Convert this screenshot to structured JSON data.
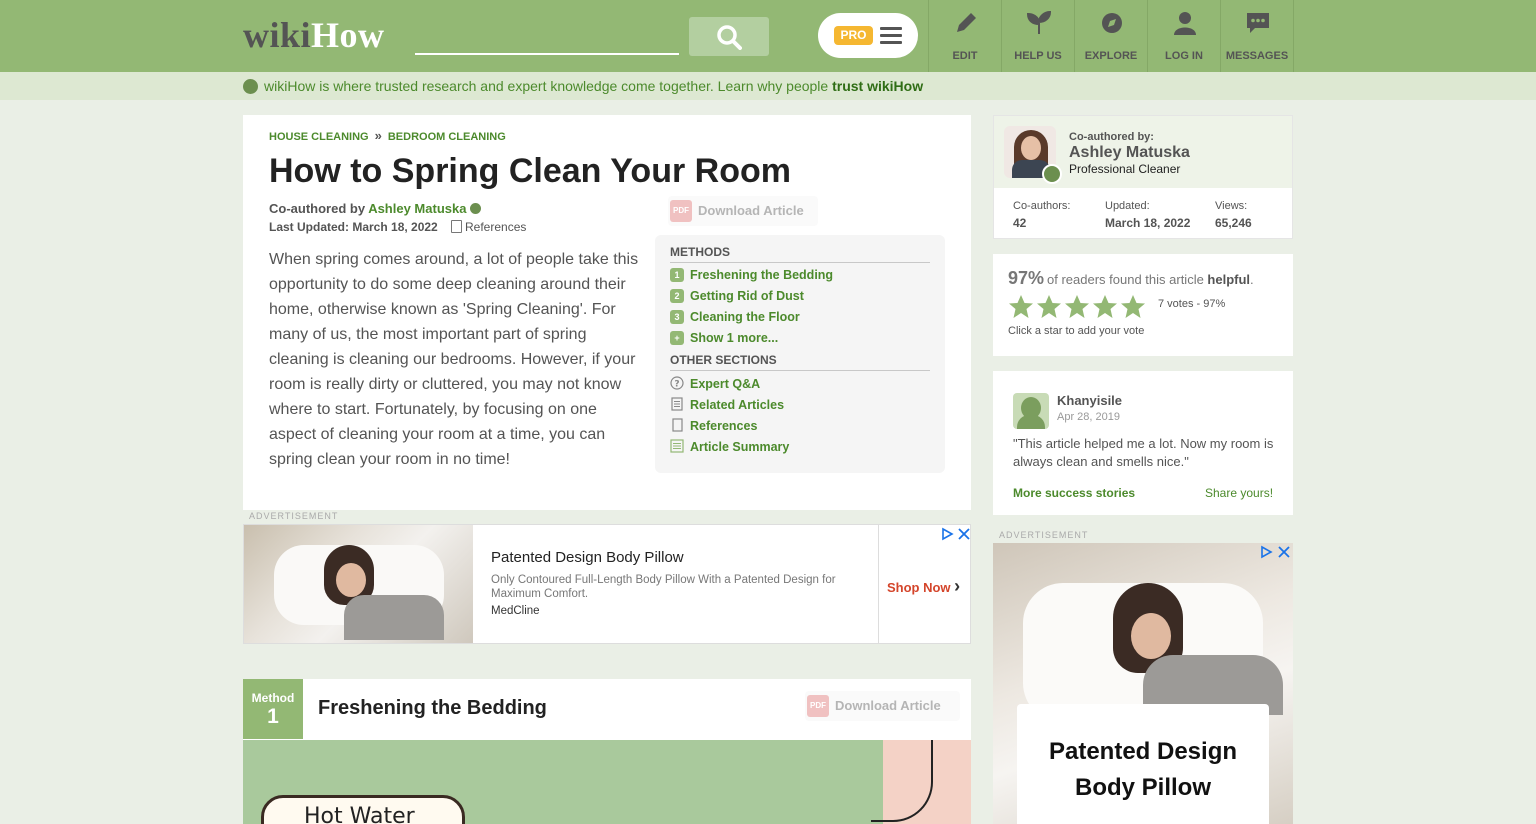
{
  "header": {
    "logo_wiki": "wiki",
    "logo_how": "How",
    "search_placeholder": "",
    "pro_label": "PRO",
    "nav": [
      {
        "label": "EDIT",
        "icon": "pencil-icon"
      },
      {
        "label": "HELP US",
        "icon": "sprout-icon"
      },
      {
        "label": "EXPLORE",
        "icon": "compass-icon"
      },
      {
        "label": "LOG IN",
        "icon": "person-icon"
      },
      {
        "label": "MESSAGES",
        "icon": "chat-icon"
      }
    ]
  },
  "trust": {
    "text": "wikiHow is where trusted research and expert knowledge come together. Learn why people ",
    "link": "trust wikiHow"
  },
  "article": {
    "breadcrumbs": [
      "HOUSE CLEANING",
      "BEDROOM CLEANING"
    ],
    "breadcrumb_sep": "»",
    "title": "How to Spring Clean Your Room",
    "coauthored_prefix": "Co-authored by ",
    "author": "Ashley Matuska",
    "last_updated": "Last Updated: March 18, 2022",
    "references_label": "References",
    "download_label": "Download Article",
    "pdf_label": "PDF",
    "intro": "When spring comes around, a lot of people take this opportunity to do some deep cleaning around their home, otherwise known as 'Spring Cleaning'. For many of us, the most important part of spring cleaning is cleaning our bedrooms. However, if your room is really dirty or cluttered, you may not know where to start. Fortunately, by focusing on one aspect of cleaning your room at a time, you can spring clean your room in no time!"
  },
  "toc": {
    "methods_heading": "METHODS",
    "methods": [
      {
        "num": "1",
        "label": "Freshening the Bedding"
      },
      {
        "num": "2",
        "label": "Getting Rid of Dust"
      },
      {
        "num": "3",
        "label": "Cleaning the Floor"
      },
      {
        "num": "+",
        "label": "Show 1 more..."
      }
    ],
    "other_heading": "OTHER SECTIONS",
    "other": [
      {
        "label": "Expert Q&A",
        "icon": "question-icon"
      },
      {
        "label": "Related Articles",
        "icon": "document-lines-icon"
      },
      {
        "label": "References",
        "icon": "document-icon"
      },
      {
        "label": "Article Summary",
        "icon": "summary-icon"
      }
    ]
  },
  "ad_banner": {
    "label": "ADVERTISEMENT",
    "title": "Patented Design Body Pillow",
    "description": "Only Contoured Full-Length Body Pillow With a Patented Design for Maximum Comfort.",
    "brand": "MedCline",
    "cta": "Shop Now",
    "cta_arrow": "›"
  },
  "method": {
    "word": "Method",
    "number": "1",
    "title": "Freshening the Bedding",
    "download_label": "Download Article",
    "image_sign_text": "Hot Water"
  },
  "sidebar": {
    "coauthored_by": "Co-authored by:",
    "author_name": "Ashley Matuska",
    "author_role": "Professional Cleaner",
    "stats": [
      {
        "label": "Co-authors:",
        "value": "42"
      },
      {
        "label": "Updated:",
        "value": "March 18, 2022"
      },
      {
        "label": "Views:",
        "value": "65,246"
      }
    ],
    "helpful_pct": "97%",
    "helpful_text_pre": "of readers found this article ",
    "helpful_text_bold": "helpful",
    "helpful_text_post": ".",
    "stars_filled": 5,
    "stars_total": 5,
    "votes": "7 votes - 97%",
    "click_star": "Click a star to add your vote",
    "story": {
      "name": "Khanyisile",
      "date": "Apr 28, 2019",
      "quote": "\"This article helped me a lot. Now my room is always clean and smells nice.\"",
      "more": "More success stories",
      "share": "Share yours!"
    },
    "ad_label": "ADVERTISEMENT",
    "ad_title": "Patented Design Body Pillow"
  },
  "colors": {
    "brand_green": "#93b874",
    "link_green": "#4c8a2c",
    "pro_yellow": "#f5b731"
  }
}
